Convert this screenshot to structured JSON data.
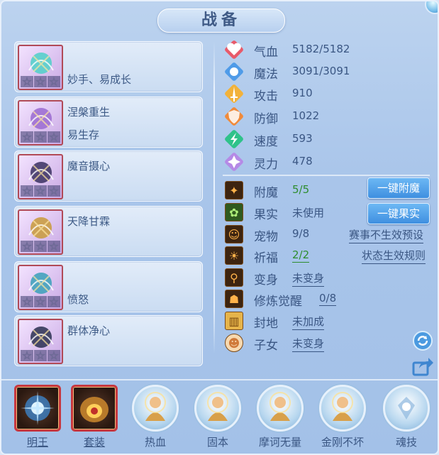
{
  "title": "战备",
  "skills": [
    {
      "names": [
        "",
        "妙手、易成长"
      ],
      "stars": [
        "☆",
        "☆",
        "☆"
      ],
      "icon": "flame-wings-skill-icon",
      "color": "#4fd0c8"
    },
    {
      "names": [
        "涅槃重生",
        "易生存"
      ],
      "stars": [
        "☆",
        "☆",
        "☆"
      ],
      "icon": "phoenix-rebirth-skill-icon",
      "color": "#9a6ad0"
    },
    {
      "names": [
        "魔音摄心",
        ""
      ],
      "stars": [
        "☆",
        "☆",
        "☆"
      ],
      "icon": "demon-sound-skill-icon",
      "color": "#3a3060"
    },
    {
      "names": [
        "天降甘霖",
        ""
      ],
      "stars": [
        "☆",
        "☆",
        "☆"
      ],
      "icon": "rain-chain-skill-icon",
      "color": "#c89a3a"
    },
    {
      "names": [
        "",
        "愤怒"
      ],
      "stars": [
        "☆",
        "☆",
        "☆"
      ],
      "icon": "fury-ring-skill-icon",
      "color": "#3aa0b8"
    },
    {
      "names": [
        "群体净心",
        ""
      ],
      "stars": [
        "☆",
        "☆",
        "☆"
      ],
      "icon": "purify-skill-icon",
      "color": "#2a3050"
    }
  ],
  "attributes": [
    {
      "label": "气血",
      "value": "5182/5182",
      "icon": "heart-icon",
      "color": "#e85a6a"
    },
    {
      "label": "魔法",
      "value": "3091/3091",
      "icon": "mana-icon",
      "color": "#4f9be8"
    },
    {
      "label": "攻击",
      "value": "910",
      "icon": "sword-icon",
      "color": "#f2b23a"
    },
    {
      "label": "防御",
      "value": "1022",
      "icon": "shield-icon",
      "color": "#f08a3a"
    },
    {
      "label": "速度",
      "value": "593",
      "icon": "speed-icon",
      "color": "#2fc28a"
    },
    {
      "label": "灵力",
      "value": "478",
      "icon": "spirit-icon",
      "color": "#b58ae6"
    }
  ],
  "extras": [
    {
      "label": "附魔",
      "value": "5/5",
      "icon": "enchant-icon",
      "green": true,
      "underline": false
    },
    {
      "label": "果实",
      "value": "未使用",
      "icon": "fruit-icon",
      "green": false,
      "underline": false
    },
    {
      "label": "宠物",
      "value": "9/8",
      "icon": "pet-icon",
      "green": false,
      "underline": false
    },
    {
      "label": "祈福",
      "value": "2/2",
      "icon": "blessing-icon",
      "green": true,
      "underline": true
    },
    {
      "label": "变身",
      "value": "未变身",
      "icon": "transform-icon",
      "green": false,
      "underline": true
    },
    {
      "label": "修炼觉醒",
      "value": "0/8",
      "icon": "cultivation-icon",
      "green": false,
      "underline": true
    },
    {
      "label": "封地",
      "value": "未加成",
      "icon": "fief-icon",
      "green": false,
      "underline": true
    },
    {
      "label": "子女",
      "value": "未变身",
      "icon": "child-icon",
      "green": false,
      "underline": true
    }
  ],
  "buttons": {
    "enchant": "一键附魔",
    "fruit": "一键果实"
  },
  "links": {
    "event_preset": "赛事不生效预设",
    "status_rules": "状态生效规则"
  },
  "bottom": [
    {
      "label": "明王",
      "type": "square",
      "icon": "mingwang-orb-icon"
    },
    {
      "label": "套装",
      "type": "square",
      "icon": "suit-armor-icon"
    },
    {
      "label": "热血",
      "type": "circle",
      "icon": "hot-blood-monk-icon"
    },
    {
      "label": "固本",
      "type": "circle",
      "icon": "guben-monk-icon"
    },
    {
      "label": "摩诃无量",
      "type": "circle",
      "icon": "mohe-monk-icon"
    },
    {
      "label": "金刚不坏",
      "type": "circle",
      "icon": "jingang-monk-icon"
    },
    {
      "label": "魂技",
      "type": "circle",
      "icon": "soul-skill-icon"
    }
  ]
}
